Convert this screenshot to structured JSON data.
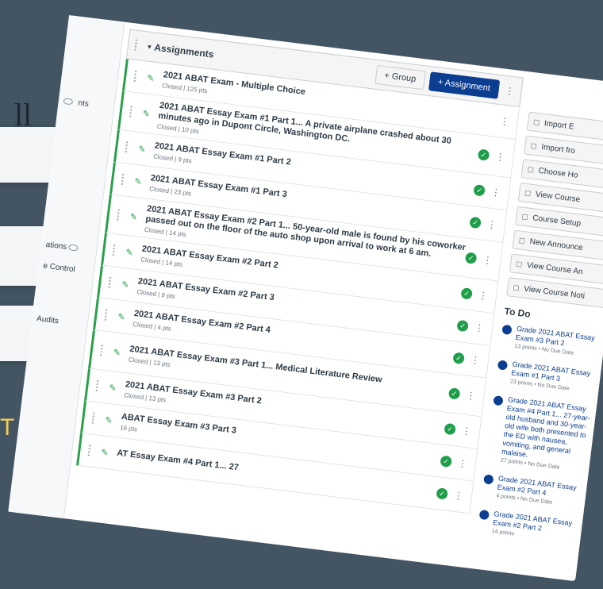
{
  "left_fragments": {
    "headline": "ll",
    "footer": "T Exam"
  },
  "left_nav": [
    {
      "label": "nts"
    },
    {
      "label": "ations"
    },
    {
      "label": "e Control"
    },
    {
      "label": "Audits"
    }
  ],
  "module": {
    "title": "Assignments",
    "group_button": "+ Group",
    "assignment_button": "+ Assignment"
  },
  "items": [
    {
      "title": "2021 ABAT Exam - Multiple Choice",
      "meta": "Closed | 125 pts",
      "done": false
    },
    {
      "title": "2021 ABAT Essay Exam #1 Part 1... A private airplane crashed about 30 minutes ago in Dupont Circle, Washington DC.",
      "meta": "Closed | 10 pts",
      "done": true
    },
    {
      "title": "2021 ABAT Essay Exam #1 Part 2",
      "meta": "Closed | 9 pts",
      "done": true
    },
    {
      "title": "2021 ABAT Essay Exam #1 Part 3",
      "meta": "Closed | 23 pts",
      "done": true
    },
    {
      "title": "2021 ABAT Essay Exam #2 Part 1... 50-year-old male is found by his coworker passed out on the floor of the auto shop upon arrival to work at 6 am.",
      "meta": "Closed | 14 pts",
      "done": true
    },
    {
      "title": "2021 ABAT Essay Exam #2 Part 2",
      "meta": "Closed | 14 pts",
      "done": true
    },
    {
      "title": "2021 ABAT Essay Exam #2 Part 3",
      "meta": "Closed | 9 pts",
      "done": true
    },
    {
      "title": "2021 ABAT Essay Exam #2 Part 4",
      "meta": "Closed | 4 pts",
      "done": true
    },
    {
      "title": "2021 ABAT Essay Exam #3 Part 1... Medical Literature Review",
      "meta": "Closed | 13 pts",
      "done": true
    },
    {
      "title": "2021 ABAT Essay Exam #3 Part 2",
      "meta": "Closed | 13 pts",
      "done": true
    },
    {
      "title": "ABAT Essay Exam #3 Part 3",
      "meta": "16 pts",
      "done": true
    },
    {
      "title": "AT Essay Exam #4 Part 1... 27",
      "meta": "",
      "done": true
    }
  ],
  "sidebar": {
    "buttons": [
      {
        "label": "Import E",
        "icon": "import-icon"
      },
      {
        "label": "Import fro",
        "icon": "import-from-icon"
      },
      {
        "label": "Choose Ho",
        "icon": "home-icon"
      },
      {
        "label": "View Course",
        "icon": "view-icon"
      },
      {
        "label": "Course Setup",
        "icon": "setup-icon"
      },
      {
        "label": "New Announce",
        "icon": "announce-icon"
      },
      {
        "label": "View Course An",
        "icon": "analytics-icon"
      },
      {
        "label": "View Course Noti",
        "icon": "bell-icon"
      }
    ],
    "todo_title": "To Do",
    "todos": [
      {
        "text": "Grade 2021 ABAT Essay Exam #3 Part 2",
        "meta": "13 points • No Due Date"
      },
      {
        "text": "Grade 2021 ABAT Essay Exam #1 Part 3",
        "meta": "23 points • No Due Date"
      },
      {
        "text": "Grade 2021 ABAT Essay Exam #4 Part 1... 27-year-old husband and 30-year-old wife both presented to the ED with nausea, vomiting, and general malaise.",
        "meta": "27 points • No Due Date"
      },
      {
        "text": "Grade 2021 ABAT Essay Exam #2 Part 4",
        "meta": "4 points • No Due Date"
      },
      {
        "text": "Grade 2021 ABAT Essay Exam #2 Part 2",
        "meta": "14 points"
      }
    ]
  }
}
